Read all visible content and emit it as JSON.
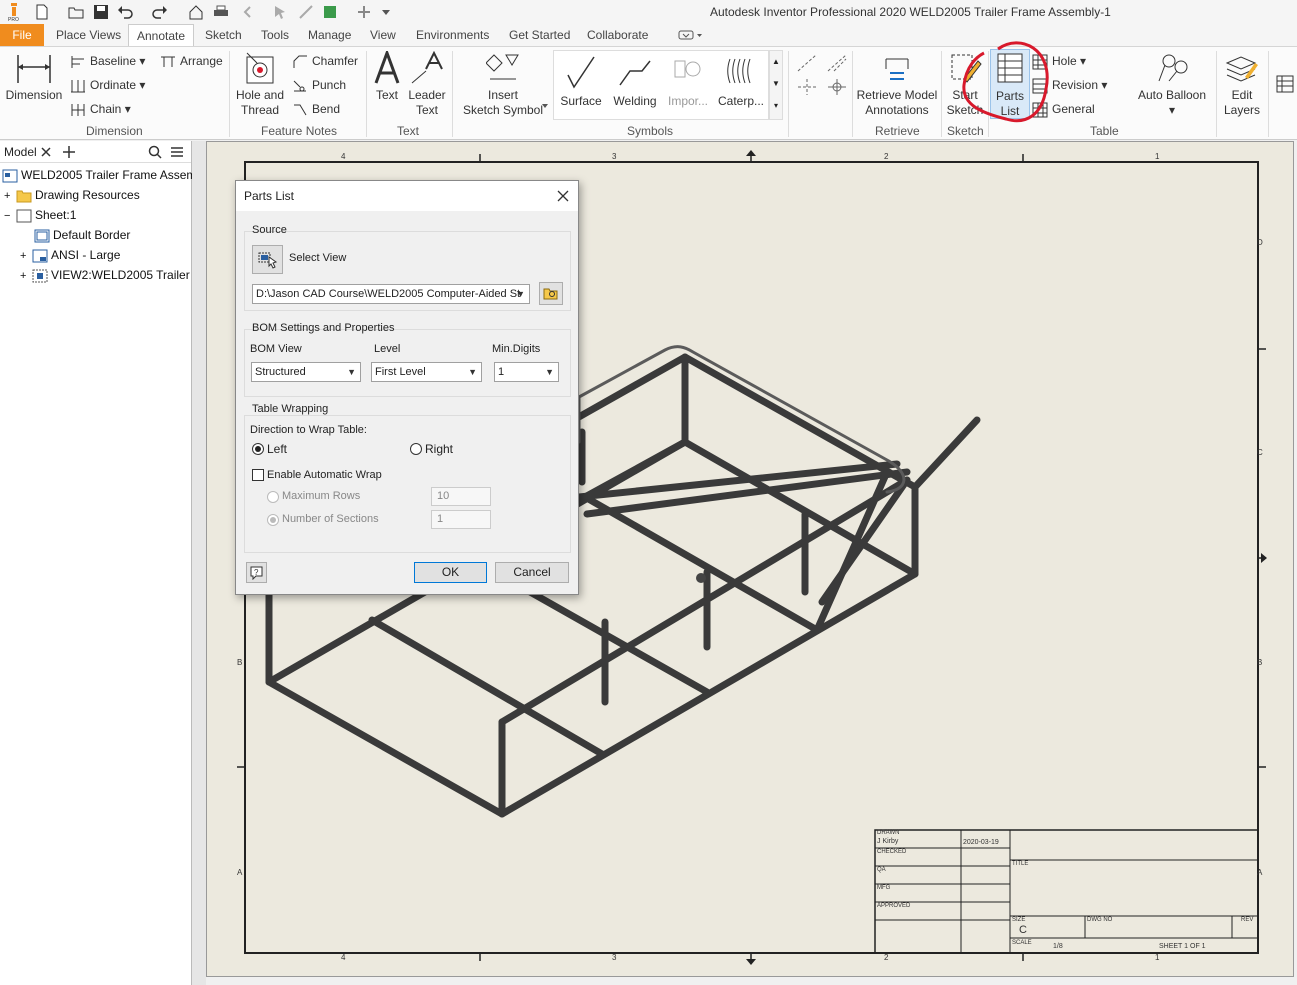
{
  "app": {
    "title": "Autodesk Inventor Professional 2020   WELD2005 Trailer Frame Assembly-1",
    "tabs": [
      "File",
      "Place Views",
      "Annotate",
      "Sketch",
      "Tools",
      "Manage",
      "View",
      "Environments",
      "Get Started",
      "Collaborate"
    ],
    "active_tab": "Annotate"
  },
  "ribbon": {
    "dimension": {
      "big": "Dimension",
      "baseline": "Baseline",
      "ordinate": "Ordinate",
      "chain": "Chain",
      "arrange": "Arrange",
      "panel": "Dimension"
    },
    "feature_notes": {
      "hole_thread_1": "Hole and",
      "hole_thread_2": "Thread",
      "chamfer": "Chamfer",
      "punch": "Punch",
      "bend": "Bend",
      "panel": "Feature Notes"
    },
    "text": {
      "text": "Text",
      "leader_1": "Leader",
      "leader_2": "Text",
      "panel": "Text"
    },
    "symbols": {
      "insert_1": "Insert",
      "insert_2": "Sketch Symbol",
      "surface": "Surface",
      "welding": "Welding",
      "import": "Impor...",
      "caterpillar": "Caterp...",
      "panel": "Symbols"
    },
    "retrieve": {
      "label_1": "Retrieve Model",
      "label_2": "Annotations",
      "panel": "Retrieve"
    },
    "sketch": {
      "label_1": "Start",
      "label_2": "Sketch",
      "panel": "Sketch"
    },
    "table": {
      "parts_1": "Parts",
      "parts_2": "List",
      "hole": "Hole",
      "revision": "Revision",
      "general": "General",
      "auto_balloon": "Auto Balloon",
      "panel": "Table"
    },
    "layers": {
      "label_1": "Edit",
      "label_2": "Layers"
    }
  },
  "browser": {
    "tab_label": "Model",
    "items": [
      "WELD2005 Trailer Frame Assembly",
      "Drawing Resources",
      "Sheet:1",
      "Default Border",
      "ANSI - Large",
      "VIEW2:WELD2005 Trailer Fr"
    ]
  },
  "dialog": {
    "title": "Parts List",
    "source_title": "Source",
    "select_view": "Select View",
    "file_path": "D:\\Jason CAD Course\\WELD2005 Computer-Aided St",
    "bom_title": "BOM Settings and Properties",
    "bom_view_label": "BOM View",
    "bom_view_value": "Structured",
    "level_label": "Level",
    "level_value": "First Level",
    "min_digits_label": "Min.Digits",
    "min_digits_value": "1",
    "wrap_title": "Table Wrapping",
    "direction_label": "Direction to Wrap Table:",
    "left": "Left",
    "right": "Right",
    "auto_wrap": "Enable Automatic Wrap",
    "max_rows": "Maximum Rows",
    "max_rows_value": "10",
    "num_sections": "Number of Sections",
    "num_sections_value": "1",
    "ok": "OK",
    "cancel": "Cancel",
    "help": "?"
  },
  "sheet": {
    "zones_top": [
      "4",
      "3",
      "2",
      "1"
    ],
    "zones_side": [
      "D",
      "C",
      "B",
      "A"
    ],
    "title_block": {
      "drawn": "DRAWN",
      "drawn_by": "J Kirby",
      "date": "2020-03-19",
      "checked": "CHECKED",
      "qa": "QA",
      "mfg": "MFG",
      "approved": "APPROVED",
      "title": "TITLE",
      "size_label": "SIZE",
      "size": "C",
      "dwg_no": "DWG NO",
      "rev": "REV",
      "scale_label": "SCALE",
      "scale": "1/8",
      "sheet": "SHEET 1  OF 1"
    }
  },
  "colors": {
    "file_tab": "#f08c1e",
    "sheet_bg": "#ece9de",
    "annotation_circle": "#d8192c"
  }
}
